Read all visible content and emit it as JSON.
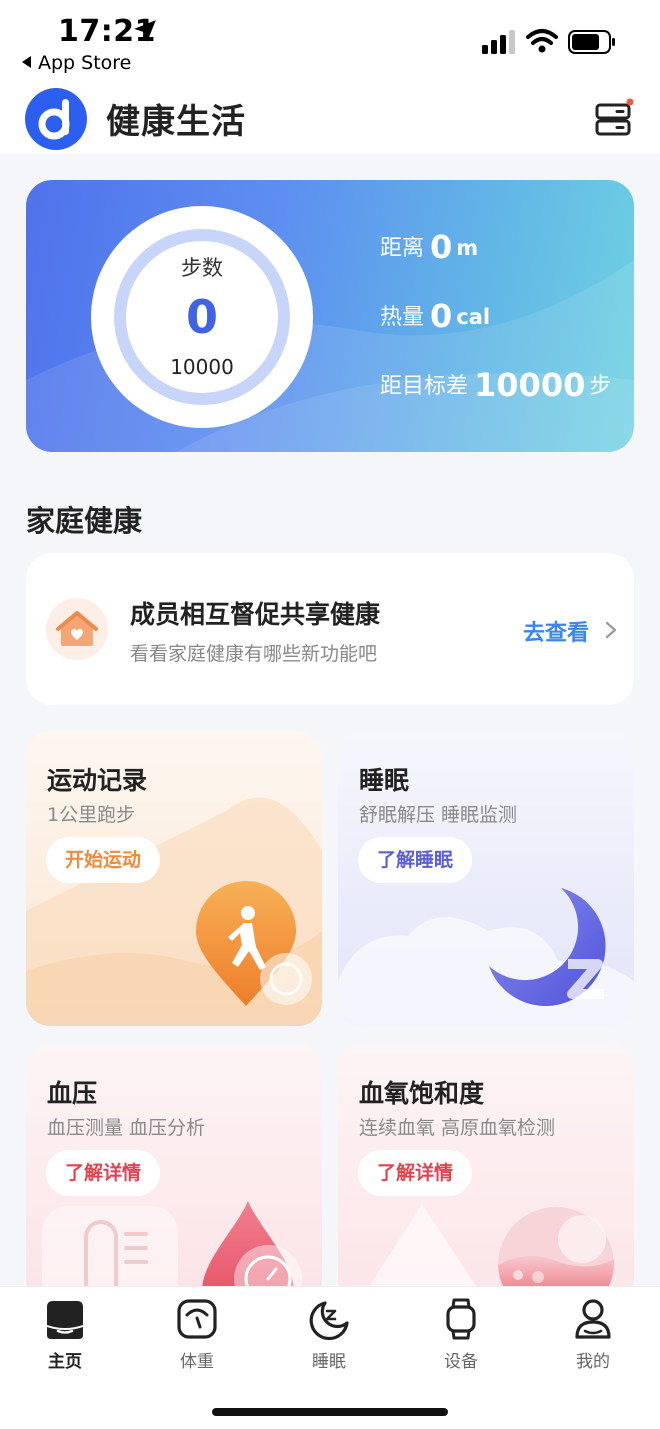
{
  "status_bar": {
    "time": "17:21",
    "back_label": "App Store"
  },
  "header": {
    "title": "健康生活"
  },
  "steps": {
    "label": "步数",
    "value": "0",
    "goal": "10000",
    "distance_label": "距离",
    "distance_value": "0",
    "distance_unit": "m",
    "calories_label": "热量",
    "calories_value": "0",
    "calories_unit": "cal",
    "remaining_label": "距目标差",
    "remaining_value": "10000",
    "remaining_unit": "步"
  },
  "family": {
    "section_title": "家庭健康",
    "title": "成员相互督促共享健康",
    "subtitle": "看看家庭健康有哪些新功能吧",
    "link": "去查看"
  },
  "cards": {
    "sport": {
      "title": "运动记录",
      "subtitle": "1公里跑步",
      "button": "开始运动",
      "button_color": "#f08a3c"
    },
    "sleep": {
      "title": "睡眠",
      "subtitle": "舒眠解压 睡眠监测",
      "button": "了解睡眠",
      "button_color": "#5b5fd6"
    },
    "bp": {
      "title": "血压",
      "subtitle": "血压测量 血压分析",
      "button": "了解详情",
      "button_color": "#e2434f"
    },
    "spo2": {
      "title": "血氧饱和度",
      "subtitle": "连续血氧 高原血氧检测",
      "button": "了解详情",
      "button_color": "#e2434f"
    }
  },
  "bottom_nav": {
    "items": [
      {
        "label": "主页",
        "icon": "home-icon",
        "active": true
      },
      {
        "label": "体重",
        "icon": "scale-icon",
        "active": false
      },
      {
        "label": "睡眠",
        "icon": "moon-icon",
        "active": false
      },
      {
        "label": "设备",
        "icon": "watch-icon",
        "active": false
      },
      {
        "label": "我的",
        "icon": "person-icon",
        "active": false
      }
    ]
  },
  "colors": {
    "brand": "#2c5ef0",
    "link": "#3b86e8"
  }
}
